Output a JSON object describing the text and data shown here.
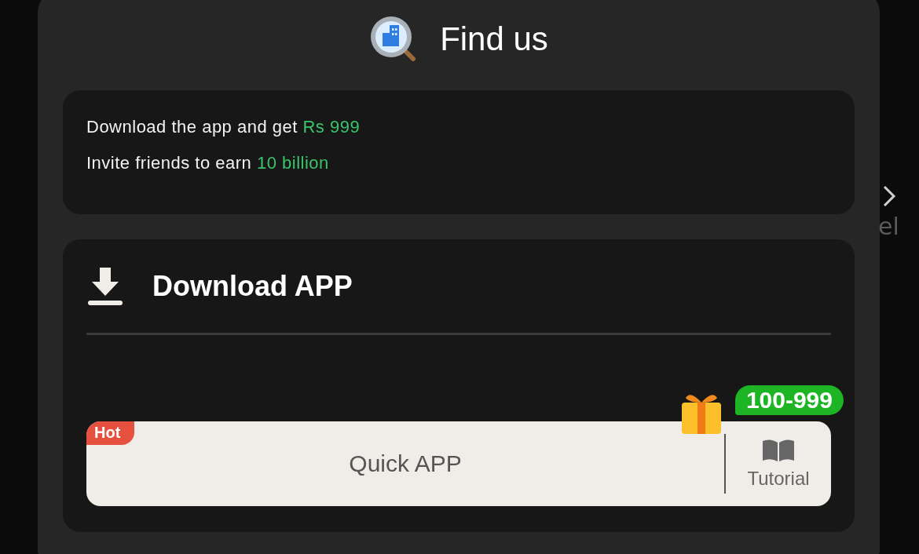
{
  "dialog": {
    "title": "Find us"
  },
  "promo": {
    "lines": [
      {
        "text": "Download the app and get ",
        "highlight": "Rs 999"
      },
      {
        "text": "Invite friends to earn ",
        "highlight": "10 billion"
      }
    ]
  },
  "download": {
    "title": "Download APP",
    "quick_button": {
      "label": "Quick APP",
      "tag": "Hot",
      "reward": "100-999"
    },
    "tutorial": {
      "label": "Tutorial"
    }
  },
  "background": {
    "fragment": "el"
  }
}
